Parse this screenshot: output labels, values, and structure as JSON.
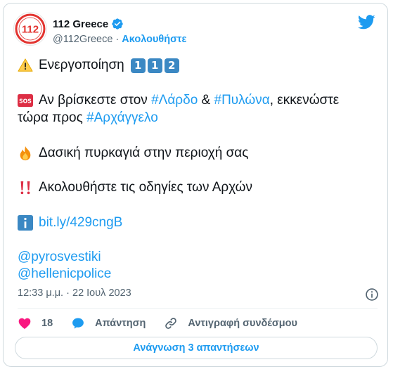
{
  "author": {
    "name": "112 Greece",
    "handle": "@112Greece",
    "separator": "·",
    "follow_label": "Ακολουθήστε",
    "avatar_text": "112"
  },
  "tweet": {
    "line1": {
      "text": "Ενεργοποίηση",
      "keycaps": [
        "1",
        "1",
        "2"
      ]
    },
    "line2": {
      "t1": "Αν βρίσκεστε στον ",
      "tag1": "#Λάρδο",
      "t2": " & ",
      "tag2": "#Πυλώνα",
      "t3": ", εκκενώστε",
      "t4": "τώρα προς ",
      "tag3": "#Αρχάγγελο"
    },
    "line3": "Δασική πυρκαγιά στην περιοχή σας",
    "line4": "Ακολουθήστε τις οδηγίες των Αρχών",
    "link": "bit.ly/429cngB",
    "mention1": "@pyrosvestiki",
    "mention2": "@hellenicpolice"
  },
  "meta": {
    "time": "12:33 μ.μ.",
    "separator": "·",
    "date": "22 Ιουλ 2023"
  },
  "actions": {
    "like_count": "18",
    "reply_label": "Απάντηση",
    "copy_label": "Αντιγραφή συνδέσμου"
  },
  "read_replies_label": "Ανάγνωση 3 απαντήσεων",
  "colors": {
    "accent": "#1d9bf0",
    "like": "#f91880",
    "muted": "#536471",
    "brand_red": "#e2332f"
  },
  "icons": {
    "bird": "twitter-bird-icon",
    "verified": "verified-badge-icon",
    "warning": "warning-icon",
    "sos": "sos-icon",
    "fire": "fire-icon",
    "exclamation": "double-exclamation-icon",
    "info": "information-icon",
    "heart": "heart-icon",
    "reply": "reply-bubble-icon",
    "link": "link-icon",
    "about": "info-circle-icon"
  }
}
